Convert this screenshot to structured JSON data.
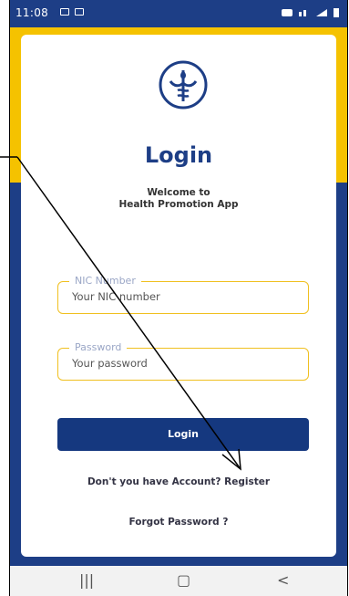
{
  "status_bar": {
    "time": "11:08"
  },
  "login": {
    "title": "Login",
    "welcome_line1": "Welcome to",
    "welcome_line2": "Health Promotion App",
    "nic_label": "NIC Number",
    "nic_placeholder": "Your NIC number",
    "password_label": "Password",
    "password_placeholder": "Your password",
    "login_button": "Login",
    "register_text": "Don't you have Account? Register",
    "forgot_text": "Forgot Password ?"
  },
  "nav": {
    "recents": "|||",
    "home": "▢",
    "back": "<"
  },
  "colors": {
    "primary": "#1d3e86",
    "accent": "#f5c200"
  }
}
